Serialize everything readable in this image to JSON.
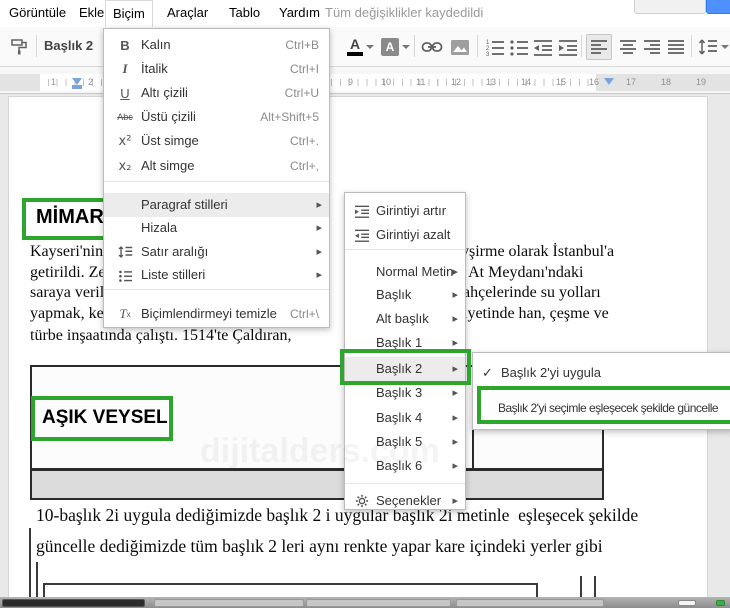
{
  "menu_bar": {
    "items": [
      {
        "label": "Görüntüle"
      },
      {
        "label": "Ekle"
      },
      {
        "label": "Biçim",
        "active": true
      },
      {
        "label": "Araçlar"
      },
      {
        "label": "Tablo"
      },
      {
        "label": "Yardım"
      }
    ],
    "status_text": "Tüm değişiklikler kaydedildi"
  },
  "toolbar": {
    "style_selector_value": "Başlık 2"
  },
  "ruler": {
    "numbers": [
      "1",
      "2",
      "9",
      "10",
      "11",
      "12",
      "13",
      "14",
      "15",
      "16",
      "17",
      "18",
      "19"
    ]
  },
  "format_menu": {
    "items": [
      {
        "label": "Kalın",
        "shortcut": "Ctrl+B"
      },
      {
        "label": "İtalik",
        "shortcut": "Ctrl+I"
      },
      {
        "label": "Altı çizili",
        "shortcut": "Ctrl+U"
      },
      {
        "label": "Üstü çizili",
        "shortcut": "Alt+Shift+5"
      },
      {
        "label": "Üst simge",
        "shortcut": "Ctrl+."
      },
      {
        "label": "Alt simge",
        "shortcut": "Ctrl+,"
      },
      {
        "label": "Paragraf stilleri",
        "shortcut": ""
      },
      {
        "label": "Hizala",
        "shortcut": ""
      },
      {
        "label": "Satır aralığı",
        "shortcut": ""
      },
      {
        "label": "Liste stilleri",
        "shortcut": ""
      },
      {
        "label": "Biçimlendirmeyi temizle",
        "shortcut": "Ctrl+\\"
      }
    ]
  },
  "paragraph_styles_menu": {
    "items": [
      {
        "label": "Girintiyi artır"
      },
      {
        "label": "Girintiyi azalt"
      },
      {
        "label": "Normal Metin"
      },
      {
        "label": "Başlık"
      },
      {
        "label": "Alt başlık"
      },
      {
        "label": "Başlık 1"
      },
      {
        "label": "Başlık 2"
      },
      {
        "label": "Başlık 3"
      },
      {
        "label": "Başlık 4"
      },
      {
        "label": "Başlık 5"
      },
      {
        "label": "Başlık 6"
      },
      {
        "label": "Seçenekler"
      }
    ]
  },
  "heading2_menu": {
    "apply_label": "Başlık 2'yi uygula",
    "apply_checked": "✓",
    "update_label": "Başlık 2'yi seçimle eşleşecek şekilde güncelle"
  },
  "document": {
    "heading_mimar": "MİMAR S",
    "body_left": [
      "Kayseri'nin",
      "getirildi. Zel",
      "saraya verile",
      "yapmak, ker"
    ],
    "body_right": [
      "vşirme olarak İstanbul'a",
      ", At Meydanı'ndaki",
      "ahçelerinde su yolları",
      "iyetinde han, çeşme ve"
    ],
    "body_line5": "türbe inşaatında çalıştı. 1514'te Çaldıran,",
    "table_heading": "AŞIK VEYSEL",
    "bottom_lines": [
      "10-başlık 2i uygula dediğimizde başlık 2 i uygular başlık 2i metinle  eşleşecek şekilde",
      "güncelle dediğimizde tüm başlık 2 leri aynı renkte yapar kare içindeki yerler gibi"
    ]
  },
  "watermark": "dijitalders.com",
  "colors": {
    "annotation_green": "#2ea52c",
    "accent_blue": "#4d90fe"
  }
}
